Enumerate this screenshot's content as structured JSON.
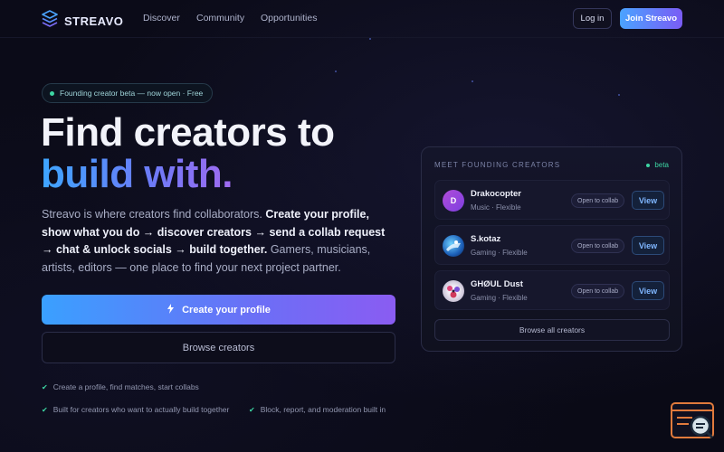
{
  "nav": {
    "logo_text": "STREAVO",
    "links": [
      "Discover",
      "Community",
      "Opportunities"
    ],
    "login_label": "Log in",
    "join_label": "Join Streavo"
  },
  "hero": {
    "pill_text": "Founding creator beta — now open · Free",
    "headline_line1": "Find creators to",
    "headline_line2": "build with.",
    "lead_intro": "Streavo is where creators find collaborators. ",
    "lead_bold": "Create your profile, show what you do → discover creators → send a collab request → chat & unlock socials → build together.",
    "lead_tail": " Gamers, musicians, artists, editors — one place to find your next project partner.",
    "create_label": "Create your profile",
    "browse_label": "Browse creators",
    "checks": [
      "Create a profile, find matches, start collabs",
      "Built for creators who want to actually build together",
      "Block, report, and moderation built in"
    ]
  },
  "card": {
    "title": "MEET FOUNDING CREATORS",
    "badge": "beta",
    "creators": [
      {
        "initial": "D",
        "name": "Drakocopter",
        "meta": "Music · Flexible",
        "status": "Open to collab",
        "action": "View"
      },
      {
        "initial": "",
        "name": "S.kotaz",
        "meta": "Gaming · Flexible",
        "status": "Open to collab",
        "action": "View"
      },
      {
        "initial": "",
        "name": "GHØUL Dust",
        "meta": "Gaming · Flexible",
        "status": "Open to collab",
        "action": "View"
      }
    ],
    "browse_all_label": "Browse all creators"
  },
  "colors": {
    "accent_blue": "#3ea6ff",
    "accent_purple": "#8a5cf2",
    "success_green": "#3dd6a3"
  },
  "icons": {
    "logo": "stacked-layers-icon",
    "create": "lightning-icon",
    "check": "check-icon",
    "widget": "chat-search-icon"
  }
}
